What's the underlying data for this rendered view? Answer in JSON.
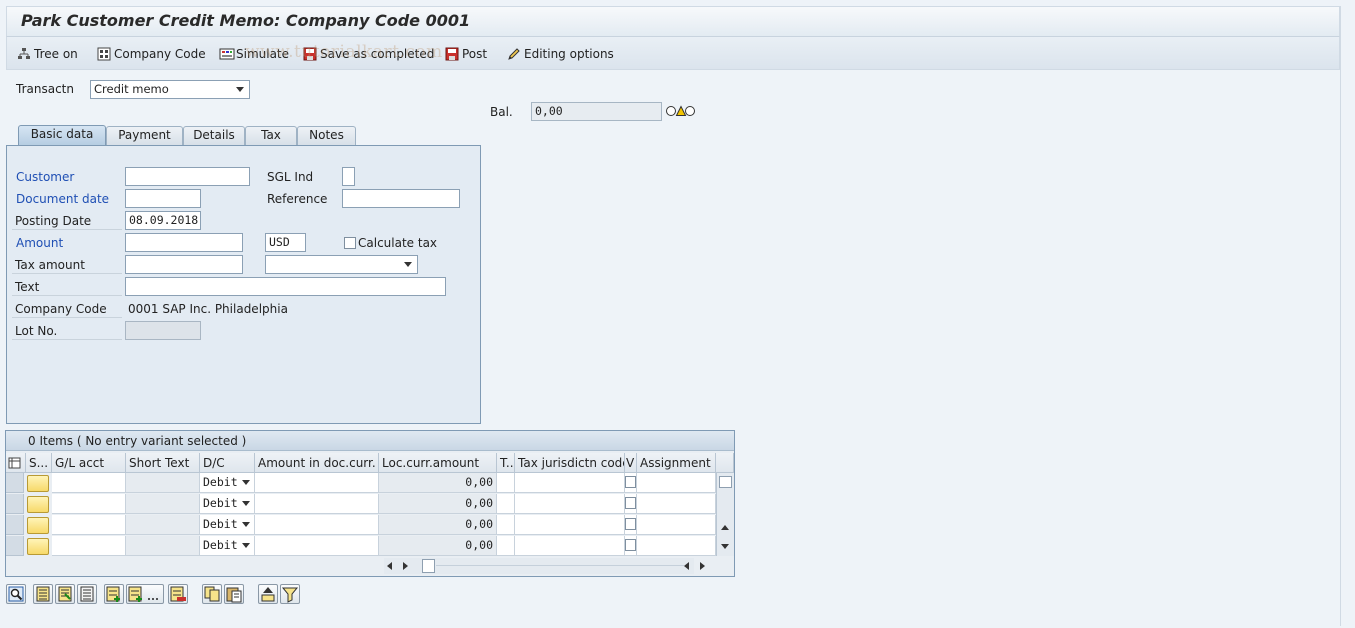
{
  "window": {
    "title": "Park Customer Credit Memo: Company Code 0001"
  },
  "toolbar": {
    "tree_on": "Tree on",
    "company_code": "Company Code",
    "simulate": "Simulate",
    "save_as_completed": "Save as completed",
    "post": "Post",
    "editing_options": "Editing options"
  },
  "watermark": "www.tutorialkart.com",
  "header": {
    "transaction_label": "Transactn",
    "transaction_value": "Credit memo",
    "balance_label": "Bal.",
    "balance_value": "0,00"
  },
  "tabs": [
    "Basic data",
    "Payment",
    "Details",
    "Tax",
    "Notes"
  ],
  "form": {
    "customer_label": "Customer",
    "customer_value": "",
    "sgl_ind_label": "SGL Ind",
    "sgl_ind_value": "",
    "document_date_label": "Document date",
    "document_date_value": "",
    "reference_label": "Reference",
    "reference_value": "",
    "posting_date_label": "Posting Date",
    "posting_date_value": "08.09.2018",
    "amount_label": "Amount",
    "amount_value": "",
    "currency_value": "USD",
    "calculate_tax_label": "Calculate tax",
    "calculate_tax_checked": false,
    "tax_amount_label": "Tax amount",
    "tax_amount_value": "",
    "tax_code_value": "",
    "text_label": "Text",
    "text_value": "",
    "company_code_label": "Company Code",
    "company_code_value": "0001 SAP Inc. Philadelphia",
    "lot_no_label": "Lot No.",
    "lot_no_value": ""
  },
  "items": {
    "summary": "0 Items ( No entry variant selected )",
    "columns": [
      "S...",
      "G/L acct",
      "Short Text",
      "D/C",
      "Amount in doc.curr.",
      "Loc.curr.amount",
      "T..",
      "Tax jurisdictn code",
      "V",
      "Assignment"
    ],
    "rows": [
      {
        "dc": "Debit",
        "loc_amount": "0,00"
      },
      {
        "dc": "Debit",
        "loc_amount": "0,00"
      },
      {
        "dc": "Debit",
        "loc_amount": "0,00"
      },
      {
        "dc": "Debit",
        "loc_amount": "0,00"
      }
    ]
  },
  "colors": {
    "background": "#eef3f8",
    "required_label": "#1f4fb4",
    "panel": "#e3ebf3",
    "yellow_button": "#f7d96a"
  }
}
